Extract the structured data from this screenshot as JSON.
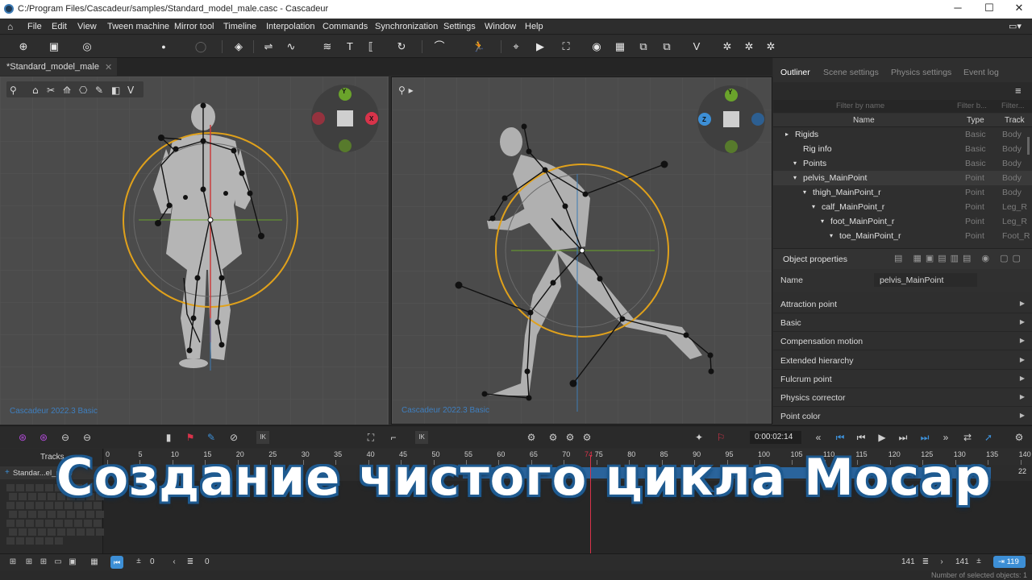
{
  "window": {
    "title": "C:/Program Files/Cascadeur/samples/Standard_model_male.casc - Cascadeur",
    "minimize": "─",
    "maximize": "☐",
    "close": "✕"
  },
  "menu": [
    "File",
    "Edit",
    "View",
    "Tween machine",
    "Mirror tool",
    "Timeline",
    "Interpolation",
    "Commands",
    "Synchronization",
    "Settings",
    "Window",
    "Help"
  ],
  "doc_tab": {
    "label": "*Standard_model_male",
    "close": "✕"
  },
  "viewport_left": {
    "watermark": "Cascadeur 2022.3 Basic",
    "gizmo": {
      "top": "Y",
      "right": "X"
    }
  },
  "viewport_right": {
    "watermark": "Cascadeur 2022.3 Basic",
    "gizmo": {
      "top": "Y",
      "left": "Z"
    }
  },
  "panel_tabs": [
    "Outliner",
    "Scene settings",
    "Physics settings",
    "Event log"
  ],
  "outliner": {
    "filter_name": "Filter by name",
    "filter_b": "Filter b...",
    "filter_c": "Filter...",
    "columns": {
      "name": "Name",
      "type": "Type",
      "track": "Track"
    },
    "rows": [
      {
        "name": "Rigids",
        "type": "Basic",
        "track": "Body",
        "arrow": "▸"
      },
      {
        "name": "Rig info",
        "type": "Basic",
        "track": "Body",
        "arrow": ""
      },
      {
        "name": "Points",
        "type": "Basic",
        "track": "Body",
        "arrow": "▾"
      },
      {
        "name": "pelvis_MainPoint",
        "type": "Point",
        "track": "Body",
        "arrow": "▾"
      },
      {
        "name": "thigh_MainPoint_r",
        "type": "Point",
        "track": "Body",
        "arrow": "▾"
      },
      {
        "name": "calf_MainPoint_r",
        "type": "Point",
        "track": "Leg_R",
        "arrow": "▾"
      },
      {
        "name": "foot_MainPoint_r",
        "type": "Point",
        "track": "Leg_R",
        "arrow": "▾"
      },
      {
        "name": "toe_MainPoint_r",
        "type": "Point",
        "track": "Foot_R",
        "arrow": "▾"
      }
    ]
  },
  "object_properties": {
    "title": "Object properties",
    "name_label": "Name",
    "name_value": "pelvis_MainPoint",
    "sections": [
      "Attraction point",
      "Basic",
      "Compensation motion",
      "Extended hierarchy",
      "Fulcrum point",
      "Physics corrector",
      "Point color"
    ]
  },
  "playback": {
    "time": "0:00:02:14",
    "ik1": "IK",
    "ik2": "IK"
  },
  "timeline": {
    "tracks_label": "Tracks",
    "track_name": "Standar...el_male",
    "ruler": [
      "0",
      "5",
      "10",
      "15",
      "20",
      "25",
      "30",
      "35",
      "40",
      "45",
      "50",
      "55",
      "60",
      "65",
      "70",
      "75",
      "80",
      "85",
      "90",
      "95",
      "100",
      "105",
      "110",
      "115",
      "120",
      "125",
      "130",
      "135",
      "140"
    ],
    "current_frame": "74",
    "right_count": "22"
  },
  "bottom": {
    "frame_a": "0",
    "frame_b": "0",
    "end_a": "141",
    "end_b": "141",
    "badge": "119"
  },
  "status": {
    "selected": "Number of selected objects: 1"
  },
  "overlay_title": "Создание чистого цикла Мосар",
  "colors": {
    "accent": "#3d8fd6",
    "orange": "#e0a11b",
    "red": "#d8334a",
    "green": "#6aa32b",
    "bg": "#2b2b2b"
  }
}
